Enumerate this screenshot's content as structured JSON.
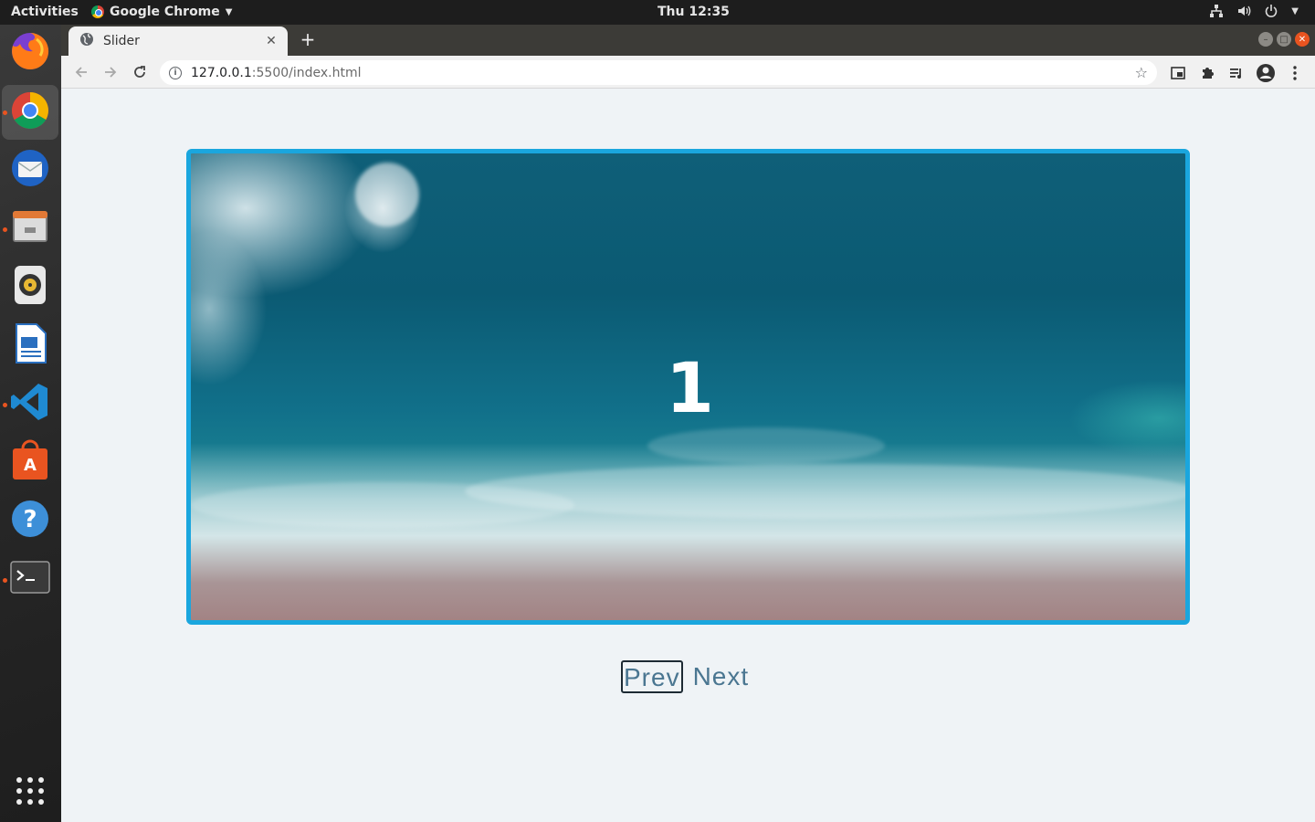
{
  "topbar": {
    "activities": "Activities",
    "app_name": "Google Chrome",
    "clock": "Thu 12:35"
  },
  "dock": {
    "items": [
      {
        "name": "Firefox",
        "icon": "firefox-icon"
      },
      {
        "name": "Google Chrome",
        "icon": "chrome-icon",
        "active": true
      },
      {
        "name": "Thunderbird",
        "icon": "thunderbird-icon"
      },
      {
        "name": "Files",
        "icon": "files-icon"
      },
      {
        "name": "Rhythmbox",
        "icon": "rhythmbox-icon"
      },
      {
        "name": "LibreOffice Writer",
        "icon": "writer-icon"
      },
      {
        "name": "Visual Studio Code",
        "icon": "vscode-icon"
      },
      {
        "name": "Ubuntu Software",
        "icon": "software-icon"
      },
      {
        "name": "Help",
        "icon": "help-icon"
      },
      {
        "name": "Terminal",
        "icon": "terminal-icon"
      },
      {
        "name": "Show Applications",
        "icon": "app-grid-icon"
      }
    ]
  },
  "browser": {
    "tab_title": "Slider",
    "url_host": "127.0.0.1",
    "url_path": ":5500/index.html"
  },
  "page": {
    "slide_number": "1",
    "prev_label": "Prev",
    "next_label": "Next",
    "colors": {
      "slider_border": "#1aa6de",
      "button_text": "#4a7691",
      "page_background": "#eff3f6"
    }
  }
}
